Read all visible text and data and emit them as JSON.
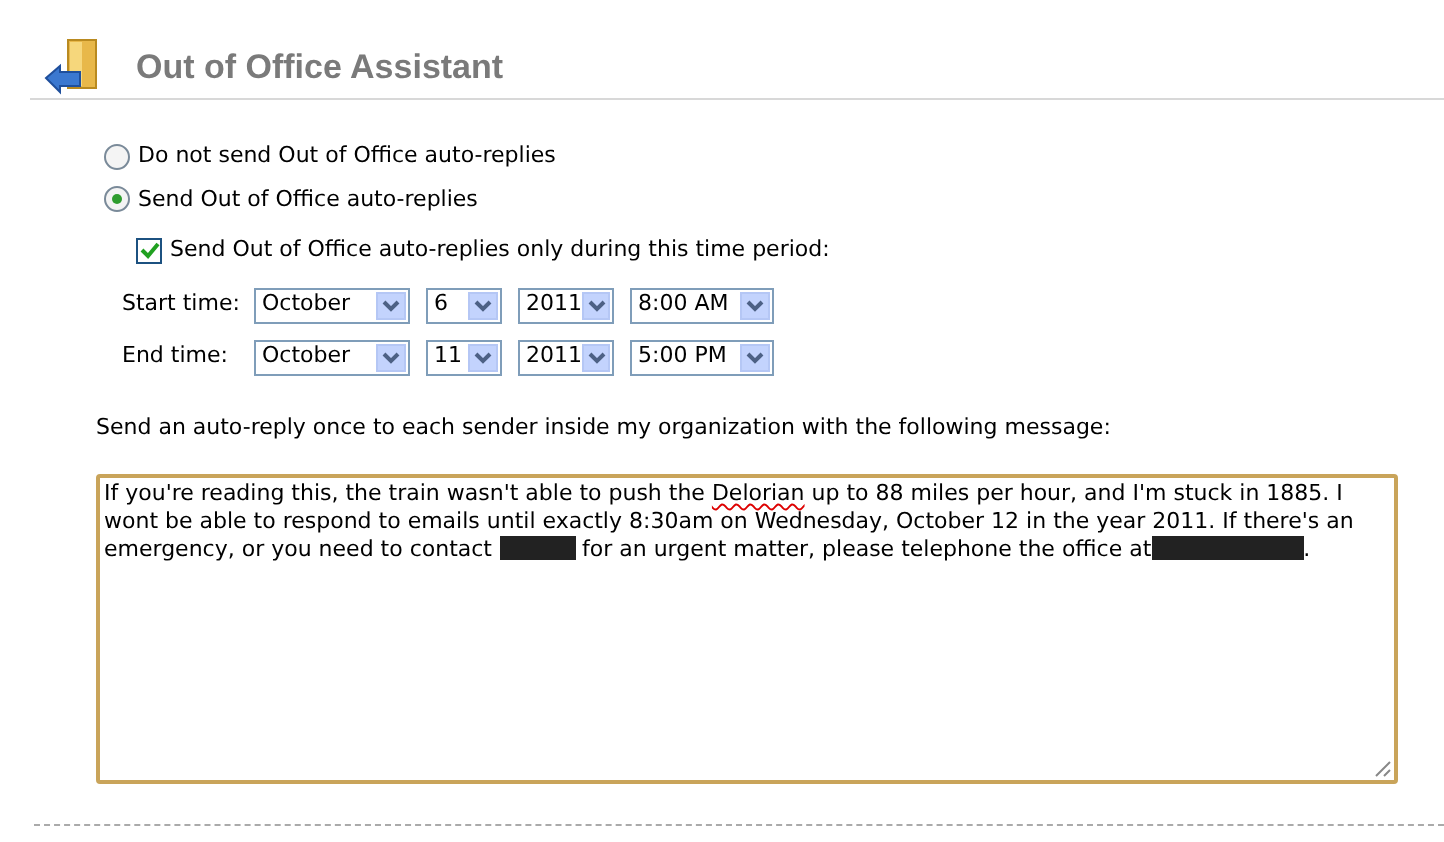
{
  "header": {
    "title": "Out of Office Assistant"
  },
  "reply_options": [
    {
      "label": "Do not send Out of Office auto-replies",
      "selected": false
    },
    {
      "label": "Send Out of Office auto-replies",
      "selected": true
    }
  ],
  "time_period": {
    "label": "Send Out of Office auto-replies only during this time period:",
    "checked": true
  },
  "time_rows": [
    {
      "label": "Start time:",
      "month": "October",
      "day": "6",
      "year": "2011",
      "time": "8:00 AM"
    },
    {
      "label": "End time:",
      "month": "October",
      "day": "11",
      "year": "2011",
      "time": "5:00 PM"
    }
  ],
  "message_label": "Send an auto-reply once to each sender inside my organization with the following message:",
  "message": [
    {
      "kind": "text",
      "text": "If you're reading this, the train wasn't able to push the "
    },
    {
      "kind": "misspelled",
      "text": "Delorian"
    },
    {
      "kind": "text",
      "text": " up to 88 miles per hour, and I'm stuck in 1885. I wont be able to respond to emails until exactly 8:30am on Wednesday, October 12 in the year 2011. If there's an emergency, or you need to contact "
    },
    {
      "kind": "redacted"
    },
    {
      "kind": "text",
      "text": " for an urgent matter, please telephone the office at"
    },
    {
      "kind": "redacted"
    },
    {
      "kind": "text",
      "text": "."
    }
  ]
}
